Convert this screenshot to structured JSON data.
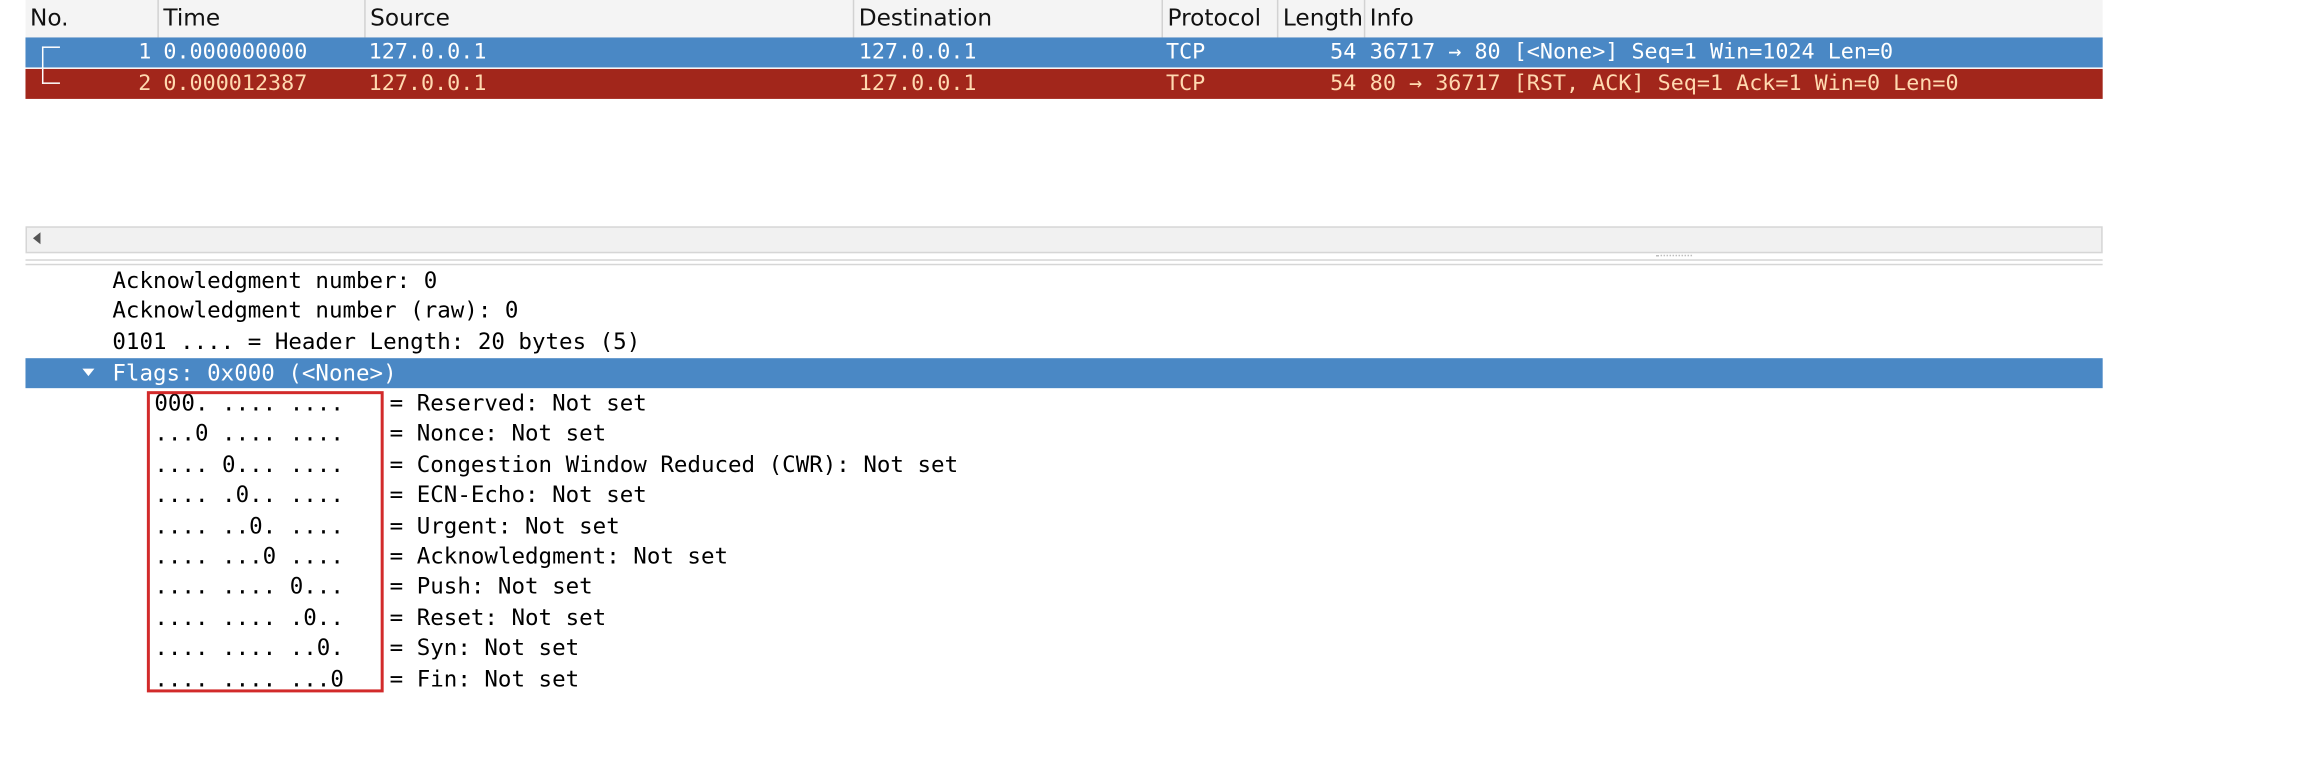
{
  "packet_list": {
    "columns": [
      "No.",
      "Time",
      "Source",
      "Destination",
      "Protocol",
      "Length",
      "Info"
    ],
    "rows": [
      {
        "no": "1",
        "time": "0.000000000",
        "source": "127.0.0.1",
        "destination": "127.0.0.1",
        "protocol": "TCP",
        "length": "54",
        "info": "36717 → 80 [<None>] Seq=1 Win=1024 Len=0"
      },
      {
        "no": "2",
        "time": "0.000012387",
        "source": "127.0.0.1",
        "destination": "127.0.0.1",
        "protocol": "TCP",
        "length": "54",
        "info": "80 → 36717 [RST, ACK] Seq=1 Ack=1 Win=0 Len=0"
      }
    ]
  },
  "details": {
    "lines": [
      "Acknowledgment number: 0",
      "Acknowledgment number (raw): 0",
      "0101 .... = Header Length: 20 bytes (5)"
    ],
    "flags_header": "Flags: 0x000 (<None>)",
    "flags": [
      {
        "bits": "000. .... ....",
        "desc": "= Reserved: Not set"
      },
      {
        "bits": "...0 .... ....",
        "desc": "= Nonce: Not set"
      },
      {
        "bits": ".... 0... ....",
        "desc": "= Congestion Window Reduced (CWR): Not set"
      },
      {
        "bits": ".... .0.. ....",
        "desc": "= ECN-Echo: Not set"
      },
      {
        "bits": ".... ..0. ....",
        "desc": "= Urgent: Not set"
      },
      {
        "bits": ".... ...0 ....",
        "desc": "= Acknowledgment: Not set"
      },
      {
        "bits": ".... .... 0...",
        "desc": "= Push: Not set"
      },
      {
        "bits": ".... .... .0..",
        "desc": "= Reset: Not set"
      },
      {
        "bits": ".... .... ..0.",
        "desc": "= Syn: Not set"
      },
      {
        "bits": ".... .... ...0",
        "desc": "= Fin: Not set"
      }
    ]
  },
  "colors": {
    "selected_row": "#4a88c5",
    "rst_row": "#a2261b",
    "highlight_box": "#d22a2a"
  }
}
